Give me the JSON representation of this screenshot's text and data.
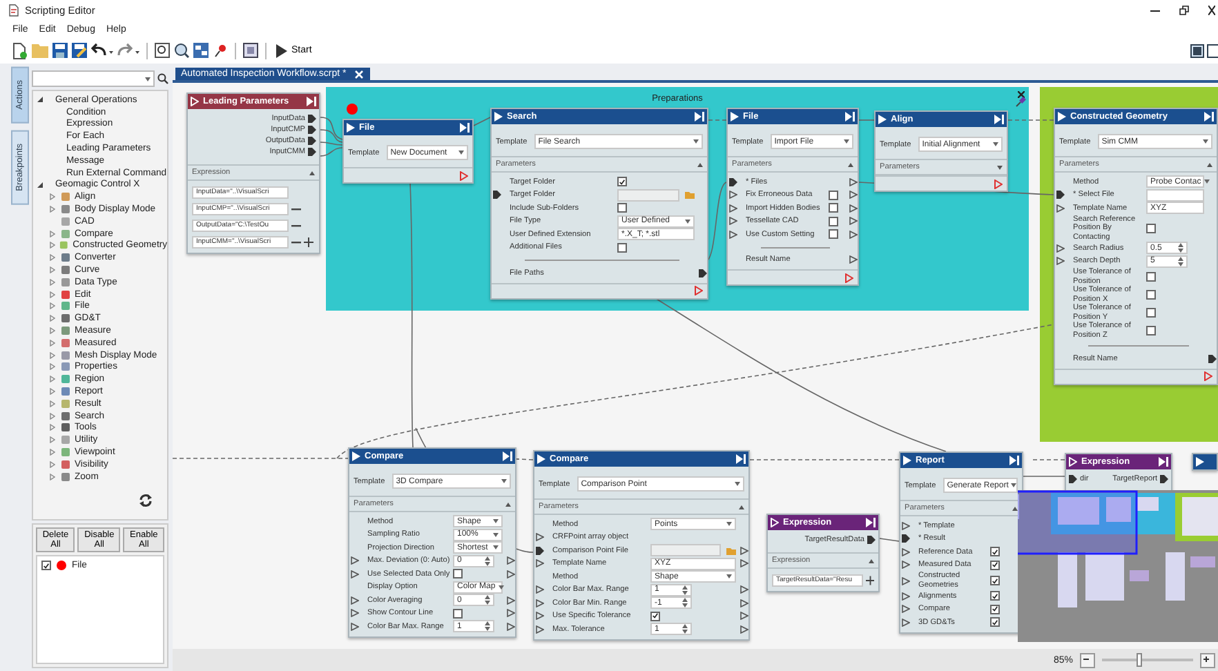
{
  "window": {
    "title": "Scripting Editor"
  },
  "menu": [
    "File",
    "Edit",
    "Debug",
    "Help"
  ],
  "toolbar": {
    "start_label": "Start"
  },
  "side_tabs": [
    {
      "label": "Actions",
      "selected": true
    },
    {
      "label": "Breakpoints",
      "selected": false
    }
  ],
  "tree": [
    {
      "label": "General Operations",
      "expanded": true,
      "children": [
        {
          "label": "Condition"
        },
        {
          "label": "Expression"
        },
        {
          "label": "For Each"
        },
        {
          "label": "Leading Parameters"
        },
        {
          "label": "Message"
        },
        {
          "label": "Run External Command"
        }
      ]
    },
    {
      "label": "Geomagic Control X",
      "expanded": true,
      "children": [
        {
          "label": "Align",
          "kind": "category",
          "expanded": false
        },
        {
          "label": "Body Display Mode",
          "kind": "category",
          "expanded": false
        },
        {
          "label": "CAD",
          "kind": "leaf"
        },
        {
          "label": "Compare",
          "kind": "category",
          "expanded": false
        },
        {
          "label": "Constructed Geometry",
          "kind": "category",
          "expanded": false
        },
        {
          "label": "Converter",
          "kind": "category",
          "expanded": false
        },
        {
          "label": "Curve",
          "kind": "category",
          "expanded": false
        },
        {
          "label": "Data Type",
          "kind": "category",
          "expanded": false
        },
        {
          "label": "Edit",
          "kind": "category",
          "expanded": false
        },
        {
          "label": "File",
          "kind": "category",
          "expanded": false
        },
        {
          "label": "GD&T",
          "kind": "category",
          "expanded": false
        },
        {
          "label": "Measure",
          "kind": "category",
          "expanded": false
        },
        {
          "label": "Measured",
          "kind": "category",
          "expanded": false
        },
        {
          "label": "Mesh Display Mode",
          "kind": "category",
          "expanded": false
        },
        {
          "label": "Properties",
          "kind": "category",
          "expanded": false
        },
        {
          "label": "Region",
          "kind": "category",
          "expanded": false
        },
        {
          "label": "Report",
          "kind": "category",
          "expanded": false
        },
        {
          "label": "Result",
          "kind": "category",
          "expanded": false
        },
        {
          "label": "Search",
          "kind": "category",
          "expanded": false
        },
        {
          "label": "Tools",
          "kind": "category",
          "expanded": false
        },
        {
          "label": "Utility",
          "kind": "category",
          "expanded": false
        },
        {
          "label": "Viewpoint",
          "kind": "category",
          "expanded": false
        },
        {
          "label": "Visibility",
          "kind": "category",
          "expanded": false
        },
        {
          "label": "Zoom",
          "kind": "category",
          "expanded": false
        }
      ]
    }
  ],
  "breakpoints": {
    "buttons": [
      "Delete All",
      "Disable All",
      "Enable All"
    ],
    "items": [
      {
        "label": "File",
        "checked": true,
        "color": "#ff0000"
      }
    ]
  },
  "document_tab": {
    "title": "Automated Inspection Workflow.scrpt *"
  },
  "groups": [
    {
      "title": "Preparations",
      "color": "#33c8cc",
      "nodes": [
        {
          "kind": "action",
          "title": "File",
          "breakpoint": true,
          "footer": true,
          "template": {
            "label": "Template",
            "value": "New Document"
          }
        },
        {
          "kind": "action",
          "title": "Search",
          "breakpoint": false,
          "footer": true,
          "template": {
            "label": "Template",
            "value": "File Search"
          },
          "section": {
            "label": "Parameters",
            "expanded": true,
            "rows": [
              {
                "label": "Target Folder",
                "kind": "check",
                "checked": true
              },
              {
                "label": "Target Folder",
                "kind": "file",
                "in": {
                  "linked": true
                }
              },
              {
                "label": "Include Sub-Folders",
                "kind": "check",
                "checked": false
              },
              {
                "label": "File Type",
                "kind": "select",
                "value": "User Defined"
              },
              {
                "label": "User Defined Extension",
                "kind": "text",
                "value": "*.X_T; *.stl"
              },
              {
                "label": "Additional Files",
                "kind": "check",
                "checked": false
              },
              {
                "kind": "divider"
              },
              {
                "label": "File Paths",
                "kind": "label",
                "out": {
                  "linked": true
                }
              }
            ]
          }
        },
        {
          "kind": "action",
          "title": "File",
          "breakpoint": false,
          "footer": true,
          "template": {
            "label": "Template",
            "value": "Import File"
          },
          "section": {
            "label": "Parameters",
            "expanded": true,
            "rows": [
              {
                "label": "* Files",
                "kind": "label",
                "in": {
                  "linked": true
                },
                "out": {
                  "linked": false
                }
              },
              {
                "label": "Fix Erroneous Data",
                "kind": "check",
                "checked": false,
                "in": {
                  "linked": false
                },
                "out": {
                  "linked": false
                }
              },
              {
                "label": "Import Hidden Bodies",
                "kind": "check",
                "checked": false,
                "in": {
                  "linked": false
                },
                "out": {
                  "linked": false
                }
              },
              {
                "label": "Tessellate CAD",
                "kind": "check",
                "checked": false,
                "in": {
                  "linked": false
                },
                "out": {
                  "linked": false
                }
              },
              {
                "label": "Use Custom Setting",
                "kind": "check",
                "checked": false,
                "in": {
                  "linked": false
                },
                "out": {
                  "linked": false
                }
              },
              {
                "kind": "divider"
              },
              {
                "label": "Result Name",
                "kind": "label",
                "out": {
                  "linked": false
                }
              }
            ]
          }
        },
        {
          "kind": "action",
          "title": "Align",
          "breakpoint": false,
          "footer": true,
          "template": {
            "label": "Template",
            "value": "Initial Alignment"
          },
          "section": {
            "label": "Parameters",
            "expanded": false
          }
        }
      ]
    },
    {
      "color": "#99cc33",
      "nodes": [
        {
          "kind": "action",
          "title": "Constructed Geometry",
          "breakpoint": false,
          "footer": true,
          "template": {
            "label": "Template",
            "value": "Sim CMM"
          },
          "section": {
            "label": "Parameters",
            "expanded": true,
            "rows": [
              {
                "label": "Method",
                "kind": "select",
                "value": "Probe Contac"
              },
              {
                "label": "* Select File",
                "kind": "text",
                "in": {
                  "linked": true
                }
              },
              {
                "label": "Template Name",
                "kind": "text",
                "value": "XYZ",
                "in": {
                  "linked": false
                }
              },
              {
                "label": "Search Reference Position By Contacting",
                "kind": "check",
                "checked": false
              },
              {
                "label": "Search Radius",
                "kind": "spin",
                "value": "0.5",
                "in": {
                  "linked": false
                }
              },
              {
                "label": "Search Depth",
                "kind": "spin",
                "value": "5",
                "in": {
                  "linked": false
                }
              },
              {
                "label": "Use Tolerance of Position",
                "kind": "check",
                "checked": false
              },
              {
                "label": "Use Tolerance of Position X",
                "kind": "check",
                "checked": false
              },
              {
                "label": "Use Tolerance of Position Y",
                "kind": "check",
                "checked": false
              },
              {
                "label": "Use Tolerance of Position Z",
                "kind": "check",
                "checked": false
              },
              {
                "kind": "divider"
              },
              {
                "label": "Result Name",
                "kind": "label",
                "out": {
                  "linked": true
                }
              }
            ]
          }
        }
      ]
    }
  ],
  "nodes": [
    {
      "kind": "parameters",
      "title": "Leading Parameters",
      "breakpoint": false,
      "footer": false,
      "outputs": [
        {
          "label": "InputData",
          "linked": true
        },
        {
          "label": "InputCMP",
          "linked": true
        },
        {
          "label": "OutputData",
          "linked": true
        },
        {
          "label": "InputCMM",
          "linked": true
        }
      ],
      "section": {
        "label": "Expression",
        "expanded": true,
        "rows": [
          {
            "kind": "expr",
            "value": "InputData=\"..\\VisualScri",
            "remove": false,
            "add": false
          },
          {
            "kind": "expr",
            "value": "InputCMP=\"..\\VisualScri",
            "remove": true,
            "add": false
          },
          {
            "kind": "expr",
            "value": "OutputData=\"C:\\TestOu",
            "remove": true,
            "add": false
          },
          {
            "kind": "expr",
            "value": "InputCMM=\"..\\VisualScri",
            "remove": true,
            "add": true
          }
        ]
      }
    },
    {
      "kind": "action",
      "title": "Compare",
      "breakpoint": false,
      "footer": false,
      "template": {
        "label": "Template",
        "value": "3D Compare"
      },
      "section": {
        "label": "Parameters",
        "expanded": true,
        "rows": [
          {
            "label": "Method",
            "kind": "select",
            "value": "Shape"
          },
          {
            "label": "Sampling Ratio",
            "kind": "select",
            "value": "100%"
          },
          {
            "label": "Projection Direction",
            "kind": "select",
            "value": "Shortest"
          },
          {
            "label": "Max. Deviation (0: Auto)",
            "kind": "spin",
            "value": "0",
            "in": {
              "linked": false
            },
            "out": {
              "linked": false
            }
          },
          {
            "label": "Use Selected Data Only",
            "kind": "check",
            "checked": false,
            "in": {
              "linked": false
            },
            "out": {
              "linked": false
            }
          },
          {
            "label": "Display Option",
            "kind": "select",
            "value": "Color Map"
          },
          {
            "label": "Color Averaging",
            "kind": "spin",
            "value": "0",
            "in": {
              "linked": false
            },
            "out": {
              "linked": false
            }
          },
          {
            "label": "Show Contour Line",
            "kind": "check",
            "checked": false,
            "in": {
              "linked": false
            },
            "out": {
              "linked": false
            }
          },
          {
            "label": "Color Bar Max. Range",
            "kind": "spin",
            "value": "1",
            "in": {
              "linked": false
            },
            "out": {
              "linked": false
            }
          }
        ]
      }
    },
    {
      "kind": "action",
      "title": "Compare",
      "breakpoint": false,
      "footer": false,
      "template": {
        "label": "Template",
        "value": "Comparison Point"
      },
      "section": {
        "label": "Parameters",
        "expanded": true,
        "rows": [
          {
            "label": "Method",
            "kind": "select",
            "value": "Points"
          },
          {
            "label": "CRFPoint array object",
            "kind": "label",
            "in": {
              "linked": false
            }
          },
          {
            "label": "Comparison Point File",
            "kind": "file",
            "in": {
              "linked": true
            },
            "out": {
              "linked": false
            }
          },
          {
            "label": "Template Name",
            "kind": "text",
            "value": "XYZ",
            "in": {
              "linked": false
            },
            "out": {
              "linked": false
            }
          },
          {
            "label": "Method",
            "kind": "select",
            "value": "Shape"
          },
          {
            "label": "Color Bar Max. Range",
            "kind": "spin",
            "value": "1",
            "in": {
              "linked": false
            },
            "out": {
              "linked": false
            }
          },
          {
            "label": "Color Bar Min. Range",
            "kind": "spin",
            "value": "-1",
            "in": {
              "linked": false
            },
            "out": {
              "linked": false
            }
          },
          {
            "label": "Use Specific Tolerance",
            "kind": "check",
            "checked": true,
            "in": {
              "linked": false
            },
            "out": {
              "linked": false
            }
          },
          {
            "label": "Max. Tolerance",
            "kind": "spin",
            "value": "1",
            "in": {
              "linked": false
            },
            "out": {
              "linked": false
            }
          }
        ]
      }
    },
    {
      "kind": "expression",
      "title": "Expression",
      "breakpoint": false,
      "footer": false,
      "outputs": [
        {
          "label": "TargetResultData",
          "linked": true
        }
      ],
      "section": {
        "label": "Expression",
        "expanded": true,
        "rows": [
          {
            "kind": "expr",
            "value": "TargetResultData=\"Resu",
            "remove": false,
            "add": true
          }
        ]
      }
    },
    {
      "kind": "action",
      "title": "Report",
      "breakpoint": false,
      "footer": false,
      "template": {
        "label": "Template",
        "value": "Generate Report"
      },
      "section": {
        "label": "Parameters",
        "expanded": true,
        "rows": [
          {
            "label": "* Template",
            "kind": "label",
            "in": {
              "linked": false
            }
          },
          {
            "label": "* Result",
            "kind": "label",
            "in": {
              "linked": true
            }
          },
          {
            "label": "Reference Data",
            "kind": "check",
            "checked": true,
            "in": {
              "linked": false
            }
          },
          {
            "label": "Measured Data",
            "kind": "check",
            "checked": true,
            "in": {
              "linked": false
            }
          },
          {
            "label": "Constructed Geometries",
            "kind": "check",
            "checked": true,
            "in": {
              "linked": false
            }
          },
          {
            "label": "Alignments",
            "kind": "check",
            "checked": true,
            "in": {
              "linked": false
            }
          },
          {
            "label": "Compare",
            "kind": "check",
            "checked": true,
            "in": {
              "linked": false
            }
          },
          {
            "label": "3D GD&Ts",
            "kind": "check",
            "checked": true,
            "in": {
              "linked": false
            }
          }
        ]
      }
    },
    {
      "kind": "expression",
      "title": "Expression",
      "breakpoint": false,
      "footer": false,
      "inputs": [
        {
          "label": "dir",
          "linked": true
        }
      ],
      "outputs": [
        {
          "label": "TargetReport",
          "linked": true
        }
      ]
    },
    {
      "kind": "action",
      "breakpoint": false,
      "footer": false
    }
  ],
  "status_bar": {
    "zoom": {
      "reading": "85%",
      "level": 0.4
    }
  }
}
